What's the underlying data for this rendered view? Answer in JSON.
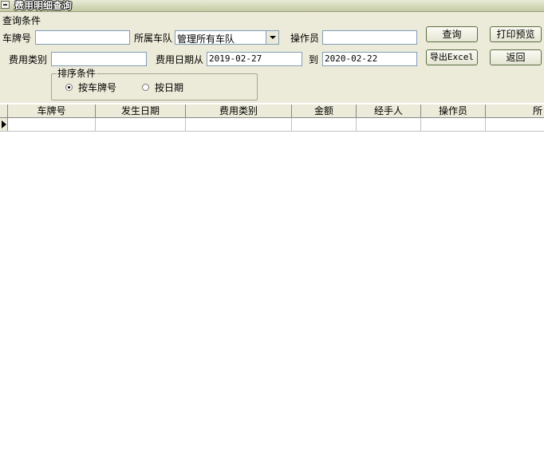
{
  "window": {
    "title": "费用明细查询"
  },
  "query": {
    "group_title": "查询条件",
    "plate_label": "车牌号",
    "plate_value": "",
    "fleet_label": "所属车队",
    "fleet_value": "管理所有车队",
    "operator_label": "操作员",
    "operator_value": "",
    "fee_type_label": "费用类别",
    "fee_type_value": "",
    "date_from_label": "费用日期从",
    "date_from_value": "2019-02-27",
    "date_to_label": "到",
    "date_to_value": "2020-02-22"
  },
  "buttons": {
    "search": "查询",
    "print_preview": "打印预览",
    "export_excel": "导出Excel",
    "back": "返回"
  },
  "sort": {
    "title": "排序条件",
    "by_plate": "按车牌号",
    "by_date": "按日期",
    "selected": "by_plate"
  },
  "grid": {
    "columns": [
      "车牌号",
      "发生日期",
      "费用类别",
      "金额",
      "经手人",
      "操作员",
      "所"
    ]
  }
}
